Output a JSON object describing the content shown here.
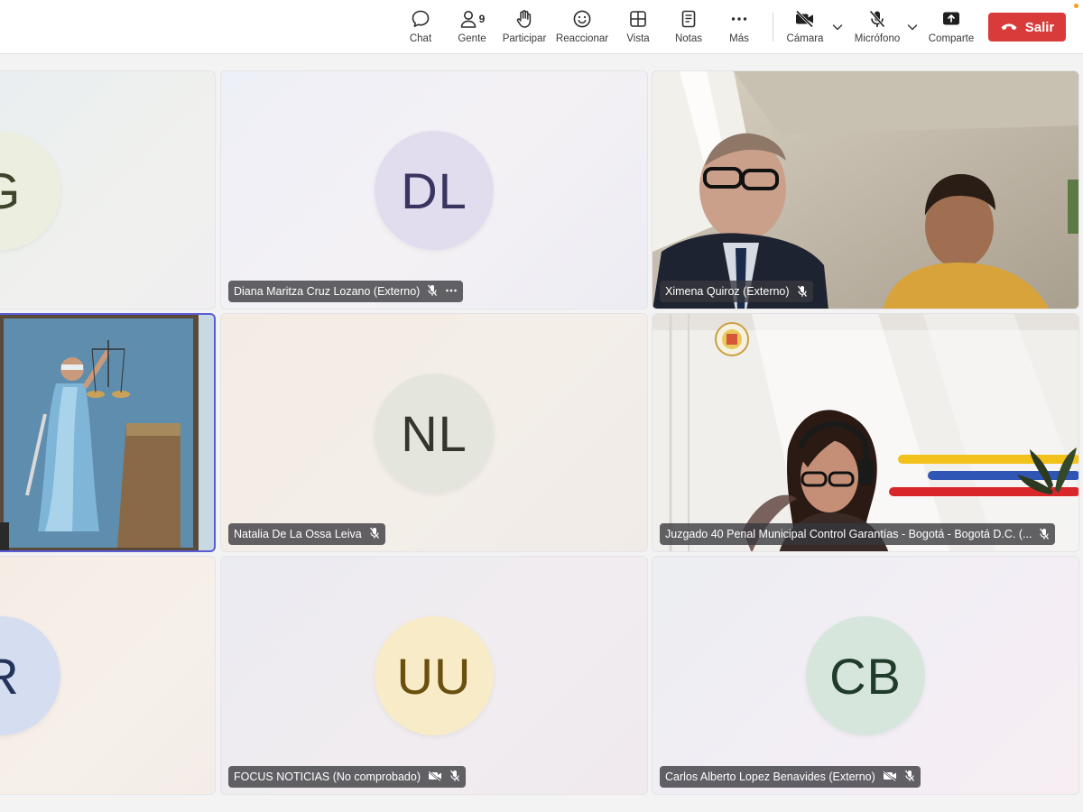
{
  "toolbar": {
    "chat": "Chat",
    "people": "Gente",
    "people_count": "9",
    "participate": "Participar",
    "react": "Reaccionar",
    "view": "Vista",
    "notes": "Notas",
    "more": "Más",
    "camera": "Cámara",
    "microphone": "Micrófono",
    "share": "Comparte",
    "leave": "Salir"
  },
  "colors": {
    "leave_red": "#d93a3a",
    "active_border": "#5b5bd6"
  },
  "tiles": [
    {
      "initials": "G",
      "name": ""
    },
    {
      "initials": "DL",
      "name": "Diana Maritza Cruz Lozano (Externo)",
      "avatar_color": "#e2dcef",
      "text_color": "#3a3560"
    },
    {
      "name": "Ximena Quiroz (Externo)"
    },
    {
      "name": ""
    },
    {
      "initials": "NL",
      "name": "Natalia De La Ossa Leiva",
      "avatar_color": "#e4e6de",
      "text_color": "#33372b"
    },
    {
      "name": "Juzgado 40 Penal Municipal Control Garantías - Bogotá - Bogotá D.C. (..."
    },
    {
      "initials": "R",
      "name": ""
    },
    {
      "initials": "UU",
      "name": "FOCUS NOTICIAS (No comprobado)",
      "avatar_color": "#f8ecc8",
      "text_color": "#6b4f0e"
    },
    {
      "initials": "CB",
      "name": "Carlos Alberto Lopez Benavides (Externo)",
      "avatar_color": "#d7e6dc",
      "text_color": "#1f3b2a"
    }
  ]
}
